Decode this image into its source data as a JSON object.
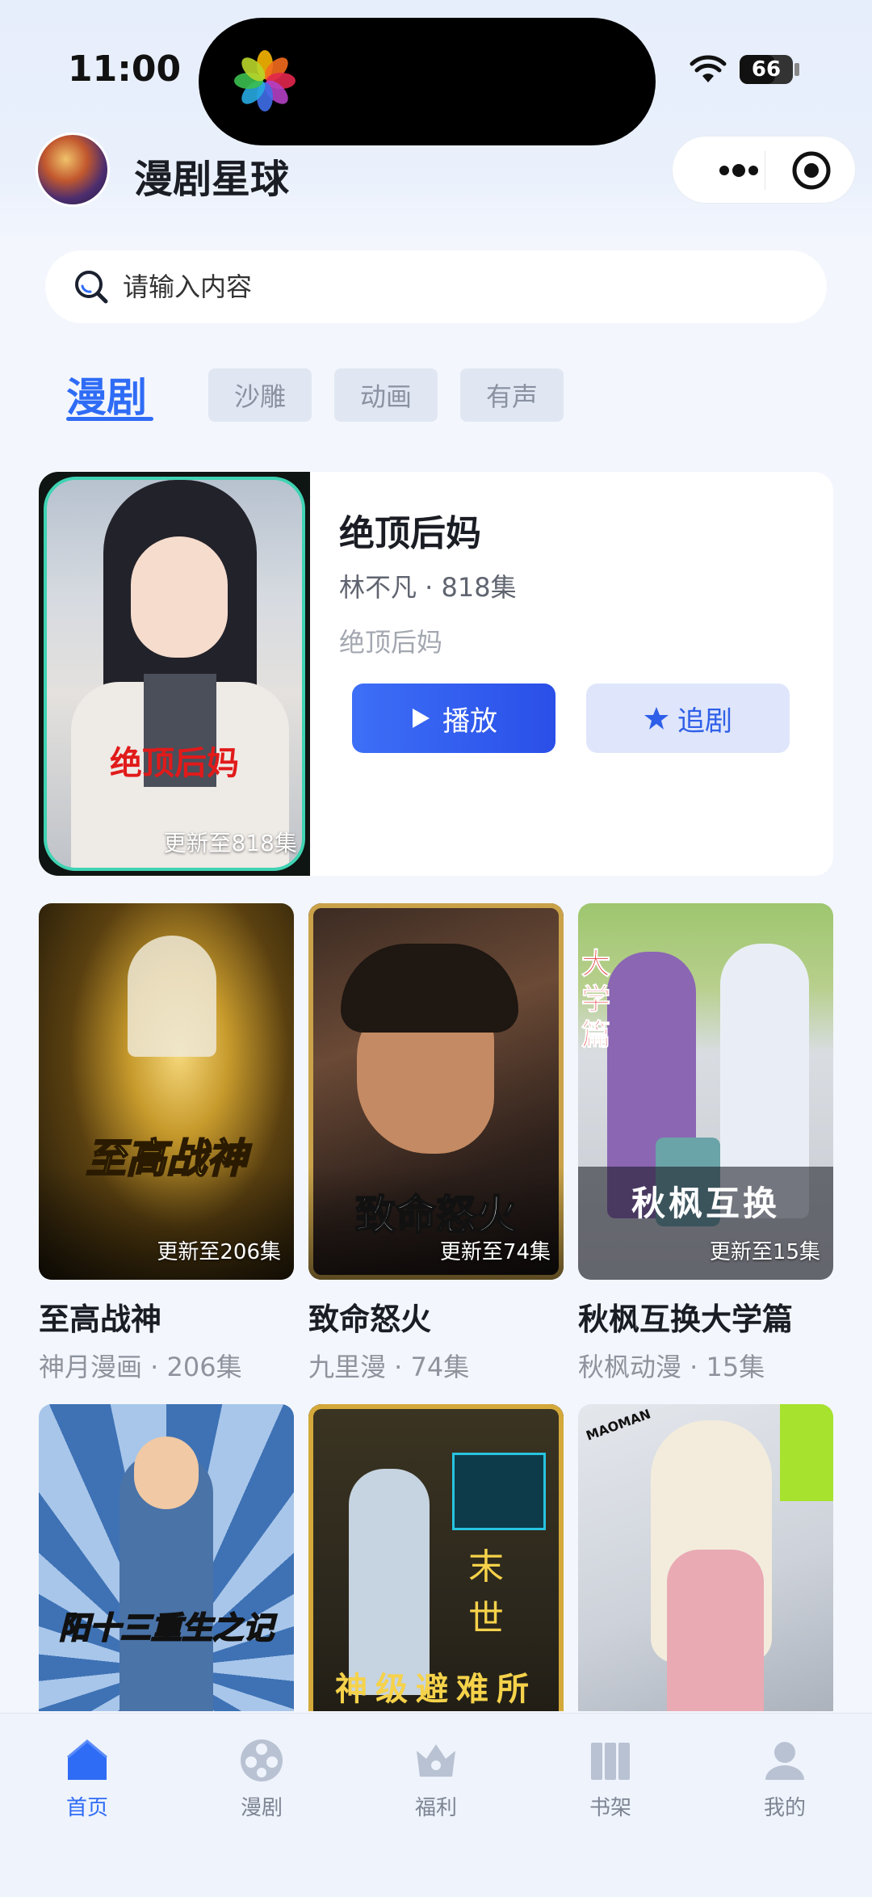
{
  "status_bar": {
    "time": "11:00",
    "battery": "66",
    "battery_level": 0.66
  },
  "header": {
    "app_title": "漫剧星球"
  },
  "search": {
    "placeholder": "请输入内容"
  },
  "tabs": {
    "active": "漫剧",
    "pills": [
      "沙雕",
      "动画",
      "有声"
    ]
  },
  "featured": {
    "title": "绝顶后妈",
    "meta": "林不凡 · 818集",
    "desc": "绝顶后妈",
    "cover_title": "绝顶后妈",
    "cover_update": "更新至818集",
    "play_label": "播放",
    "follow_label": "追剧"
  },
  "grid": [
    {
      "cover_title": "至高战神",
      "cover_update": "更新至206集",
      "title": "至高战神",
      "meta": "神月漫画 · 206集"
    },
    {
      "cover_title": "致命怒火",
      "cover_update": "更新至74集",
      "title": "致命怒火",
      "meta": "九里漫 · 74集"
    },
    {
      "cover_title": "秋枫互换",
      "cover_side_text": "大学篇",
      "cover_update": "更新至15集",
      "title": "秋枫互换大学篇",
      "meta": "秋枫动漫 · 15集"
    }
  ],
  "row3": [
    {
      "cover_title": "阳十三重生之记"
    },
    {
      "cover_side_text": "末世",
      "cover_title": "神级避难所"
    },
    {
      "cover_brand": "MAOMAN"
    }
  ],
  "bottom_nav": [
    {
      "label": "首页",
      "icon": "home-icon",
      "active": true
    },
    {
      "label": "漫剧",
      "icon": "film-reel-icon",
      "active": false
    },
    {
      "label": "福利",
      "icon": "crown-icon",
      "active": false
    },
    {
      "label": "书架",
      "icon": "bookshelf-icon",
      "active": false
    },
    {
      "label": "我的",
      "icon": "profile-icon",
      "active": false
    }
  ],
  "colors": {
    "accent": "#2f6cf6",
    "background": "#f3f6fc",
    "cover_title_red": "#e11a1a"
  }
}
